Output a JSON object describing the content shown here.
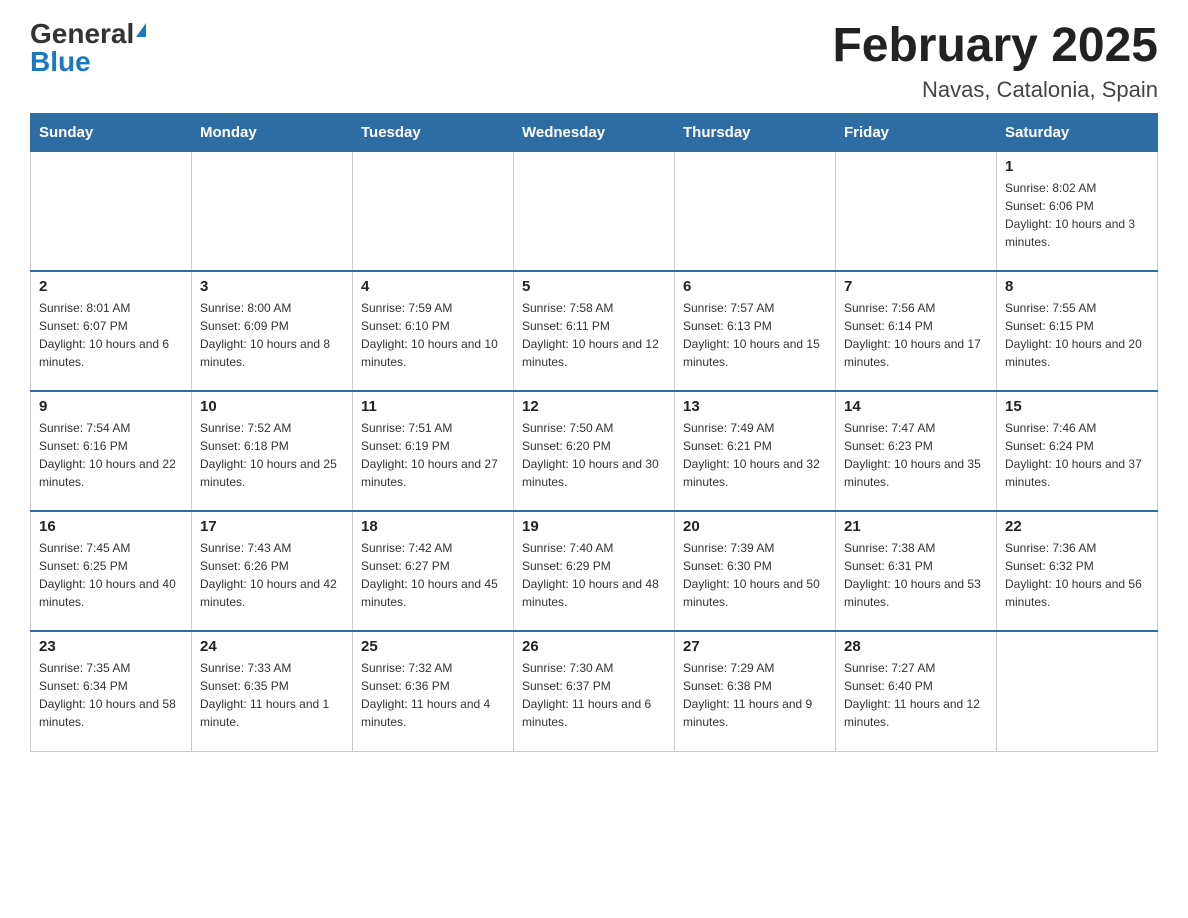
{
  "header": {
    "logo_general": "General",
    "logo_blue": "Blue",
    "month_title": "February 2025",
    "location": "Navas, Catalonia, Spain"
  },
  "weekdays": [
    "Sunday",
    "Monday",
    "Tuesday",
    "Wednesday",
    "Thursday",
    "Friday",
    "Saturday"
  ],
  "weeks": [
    [
      {
        "day": "",
        "info": ""
      },
      {
        "day": "",
        "info": ""
      },
      {
        "day": "",
        "info": ""
      },
      {
        "day": "",
        "info": ""
      },
      {
        "day": "",
        "info": ""
      },
      {
        "day": "",
        "info": ""
      },
      {
        "day": "1",
        "info": "Sunrise: 8:02 AM\nSunset: 6:06 PM\nDaylight: 10 hours and 3 minutes."
      }
    ],
    [
      {
        "day": "2",
        "info": "Sunrise: 8:01 AM\nSunset: 6:07 PM\nDaylight: 10 hours and 6 minutes."
      },
      {
        "day": "3",
        "info": "Sunrise: 8:00 AM\nSunset: 6:09 PM\nDaylight: 10 hours and 8 minutes."
      },
      {
        "day": "4",
        "info": "Sunrise: 7:59 AM\nSunset: 6:10 PM\nDaylight: 10 hours and 10 minutes."
      },
      {
        "day": "5",
        "info": "Sunrise: 7:58 AM\nSunset: 6:11 PM\nDaylight: 10 hours and 12 minutes."
      },
      {
        "day": "6",
        "info": "Sunrise: 7:57 AM\nSunset: 6:13 PM\nDaylight: 10 hours and 15 minutes."
      },
      {
        "day": "7",
        "info": "Sunrise: 7:56 AM\nSunset: 6:14 PM\nDaylight: 10 hours and 17 minutes."
      },
      {
        "day": "8",
        "info": "Sunrise: 7:55 AM\nSunset: 6:15 PM\nDaylight: 10 hours and 20 minutes."
      }
    ],
    [
      {
        "day": "9",
        "info": "Sunrise: 7:54 AM\nSunset: 6:16 PM\nDaylight: 10 hours and 22 minutes."
      },
      {
        "day": "10",
        "info": "Sunrise: 7:52 AM\nSunset: 6:18 PM\nDaylight: 10 hours and 25 minutes."
      },
      {
        "day": "11",
        "info": "Sunrise: 7:51 AM\nSunset: 6:19 PM\nDaylight: 10 hours and 27 minutes."
      },
      {
        "day": "12",
        "info": "Sunrise: 7:50 AM\nSunset: 6:20 PM\nDaylight: 10 hours and 30 minutes."
      },
      {
        "day": "13",
        "info": "Sunrise: 7:49 AM\nSunset: 6:21 PM\nDaylight: 10 hours and 32 minutes."
      },
      {
        "day": "14",
        "info": "Sunrise: 7:47 AM\nSunset: 6:23 PM\nDaylight: 10 hours and 35 minutes."
      },
      {
        "day": "15",
        "info": "Sunrise: 7:46 AM\nSunset: 6:24 PM\nDaylight: 10 hours and 37 minutes."
      }
    ],
    [
      {
        "day": "16",
        "info": "Sunrise: 7:45 AM\nSunset: 6:25 PM\nDaylight: 10 hours and 40 minutes."
      },
      {
        "day": "17",
        "info": "Sunrise: 7:43 AM\nSunset: 6:26 PM\nDaylight: 10 hours and 42 minutes."
      },
      {
        "day": "18",
        "info": "Sunrise: 7:42 AM\nSunset: 6:27 PM\nDaylight: 10 hours and 45 minutes."
      },
      {
        "day": "19",
        "info": "Sunrise: 7:40 AM\nSunset: 6:29 PM\nDaylight: 10 hours and 48 minutes."
      },
      {
        "day": "20",
        "info": "Sunrise: 7:39 AM\nSunset: 6:30 PM\nDaylight: 10 hours and 50 minutes."
      },
      {
        "day": "21",
        "info": "Sunrise: 7:38 AM\nSunset: 6:31 PM\nDaylight: 10 hours and 53 minutes."
      },
      {
        "day": "22",
        "info": "Sunrise: 7:36 AM\nSunset: 6:32 PM\nDaylight: 10 hours and 56 minutes."
      }
    ],
    [
      {
        "day": "23",
        "info": "Sunrise: 7:35 AM\nSunset: 6:34 PM\nDaylight: 10 hours and 58 minutes."
      },
      {
        "day": "24",
        "info": "Sunrise: 7:33 AM\nSunset: 6:35 PM\nDaylight: 11 hours and 1 minute."
      },
      {
        "day": "25",
        "info": "Sunrise: 7:32 AM\nSunset: 6:36 PM\nDaylight: 11 hours and 4 minutes."
      },
      {
        "day": "26",
        "info": "Sunrise: 7:30 AM\nSunset: 6:37 PM\nDaylight: 11 hours and 6 minutes."
      },
      {
        "day": "27",
        "info": "Sunrise: 7:29 AM\nSunset: 6:38 PM\nDaylight: 11 hours and 9 minutes."
      },
      {
        "day": "28",
        "info": "Sunrise: 7:27 AM\nSunset: 6:40 PM\nDaylight: 11 hours and 12 minutes."
      },
      {
        "day": "",
        "info": ""
      }
    ]
  ]
}
